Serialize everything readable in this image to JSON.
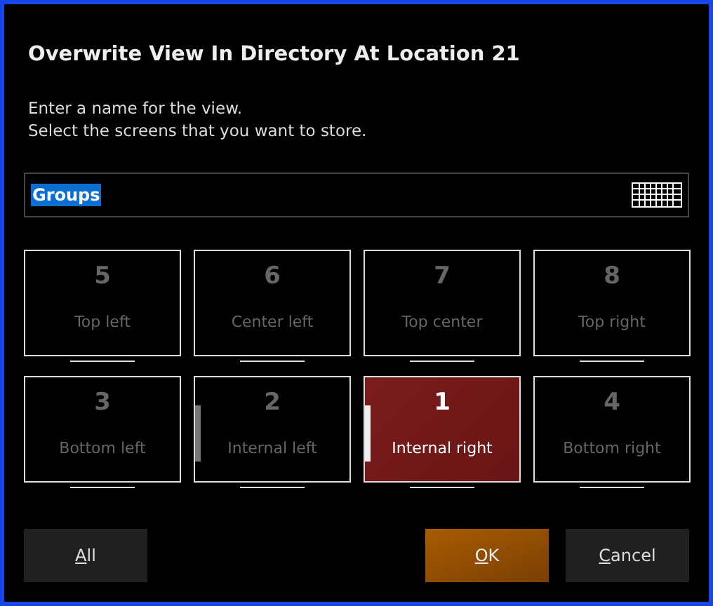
{
  "dialog": {
    "title": "Overwrite View In Directory At Location 21",
    "instructions": [
      "Enter a name for the view.",
      "Select the screens that you want to store."
    ]
  },
  "name_field": {
    "value": "Groups",
    "text_selected": true
  },
  "screens": [
    {
      "number": "5",
      "label": "Top left",
      "selected": false,
      "in_use": false,
      "active": false
    },
    {
      "number": "6",
      "label": "Center left",
      "selected": false,
      "in_use": false,
      "active": false
    },
    {
      "number": "7",
      "label": "Top center",
      "selected": false,
      "in_use": false,
      "active": false
    },
    {
      "number": "8",
      "label": "Top right",
      "selected": false,
      "in_use": false,
      "active": false
    },
    {
      "number": "3",
      "label": "Bottom left",
      "selected": false,
      "in_use": false,
      "active": false
    },
    {
      "number": "2",
      "label": "Internal left",
      "selected": false,
      "in_use": true,
      "active": false
    },
    {
      "number": "1",
      "label": "Internal right",
      "selected": true,
      "in_use": true,
      "active": true
    },
    {
      "number": "4",
      "label": "Bottom right",
      "selected": false,
      "in_use": false,
      "active": false
    }
  ],
  "buttons": [
    {
      "label": "All",
      "kind": "plain"
    },
    {
      "label": "OK",
      "kind": "primary"
    },
    {
      "label": "Cancel",
      "kind": "plain"
    }
  ]
}
